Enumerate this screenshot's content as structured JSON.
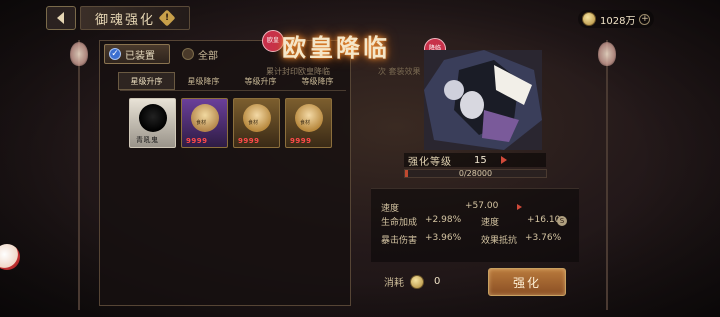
{
  "header": {
    "back_icon": "back-arrow-icon",
    "title": "御魂强化",
    "info_icon": "info-diamond-icon"
  },
  "currency": {
    "icon": "coin-icon",
    "amount": "1028万",
    "add_icon": "plus-icon"
  },
  "filters": {
    "equipped_label": "已装置",
    "all_label": "全部"
  },
  "sort_tabs": [
    {
      "label": "星级升序",
      "active": true
    },
    {
      "label": "星级降序",
      "active": false
    },
    {
      "label": "等级升序",
      "active": false
    },
    {
      "label": "等级降序",
      "active": false
    }
  ],
  "cards": [
    {
      "style": "white",
      "value": "青吼鬼",
      "tag": ""
    },
    {
      "style": "purple",
      "value": "9999",
      "tag": "食材"
    },
    {
      "style": "gold",
      "value": "9999",
      "tag": "食材"
    },
    {
      "style": "gold",
      "value": "9999",
      "tag": "食材"
    }
  ],
  "banner": {
    "title": "欧皇降临",
    "seal_left": "欧皇",
    "seal_right": "降临",
    "subline": "累计封印欧皇降临",
    "subline2": "次 套装效果"
  },
  "enhance": {
    "level_label": "强化等级",
    "level": "15",
    "exp_text": "0/28000",
    "exp_fraction": 0.02
  },
  "stats": {
    "main_name": "速度",
    "main_value": "+57.00",
    "sub": [
      {
        "name": "生命加成",
        "value": "+2.98%"
      },
      {
        "name": "速度",
        "value": "+16.10"
      },
      {
        "name": "暴击伤害",
        "value": "+3.96%"
      },
      {
        "name": "效果抵抗",
        "value": "+3.76%"
      }
    ]
  },
  "cost": {
    "label": "消耗",
    "value": "0"
  },
  "buttons": {
    "enhance_label": "强化"
  },
  "colors": {
    "accent_red": "#d04a3a",
    "button_gold": "#b97a3c",
    "panel_border": "#564535"
  }
}
